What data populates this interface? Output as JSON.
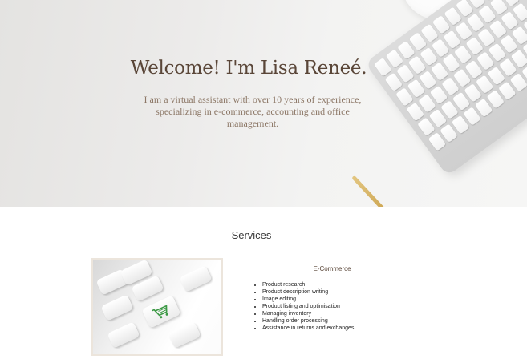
{
  "hero": {
    "title": "Welcome! I'm Lisa Reneé.",
    "subtitle": "I am a virtual assistant with over 10 years of experience, specializing in e-commerce, accounting and office management."
  },
  "services": {
    "heading": "Services",
    "items": [
      {
        "title": "E-Commerce",
        "bullets": [
          "Product research",
          "Product description writing",
          "Image editing",
          "Product listing and optimisation",
          "Managing inventory",
          "Handling order processing",
          "Assistance in returns and exchanges"
        ]
      }
    ]
  },
  "icons": {
    "cart": "shopping-cart-icon"
  },
  "colors": {
    "title_brown": "#5a4638",
    "subtitle_brown": "#8c7766",
    "cart_green": "#3d9a46"
  }
}
